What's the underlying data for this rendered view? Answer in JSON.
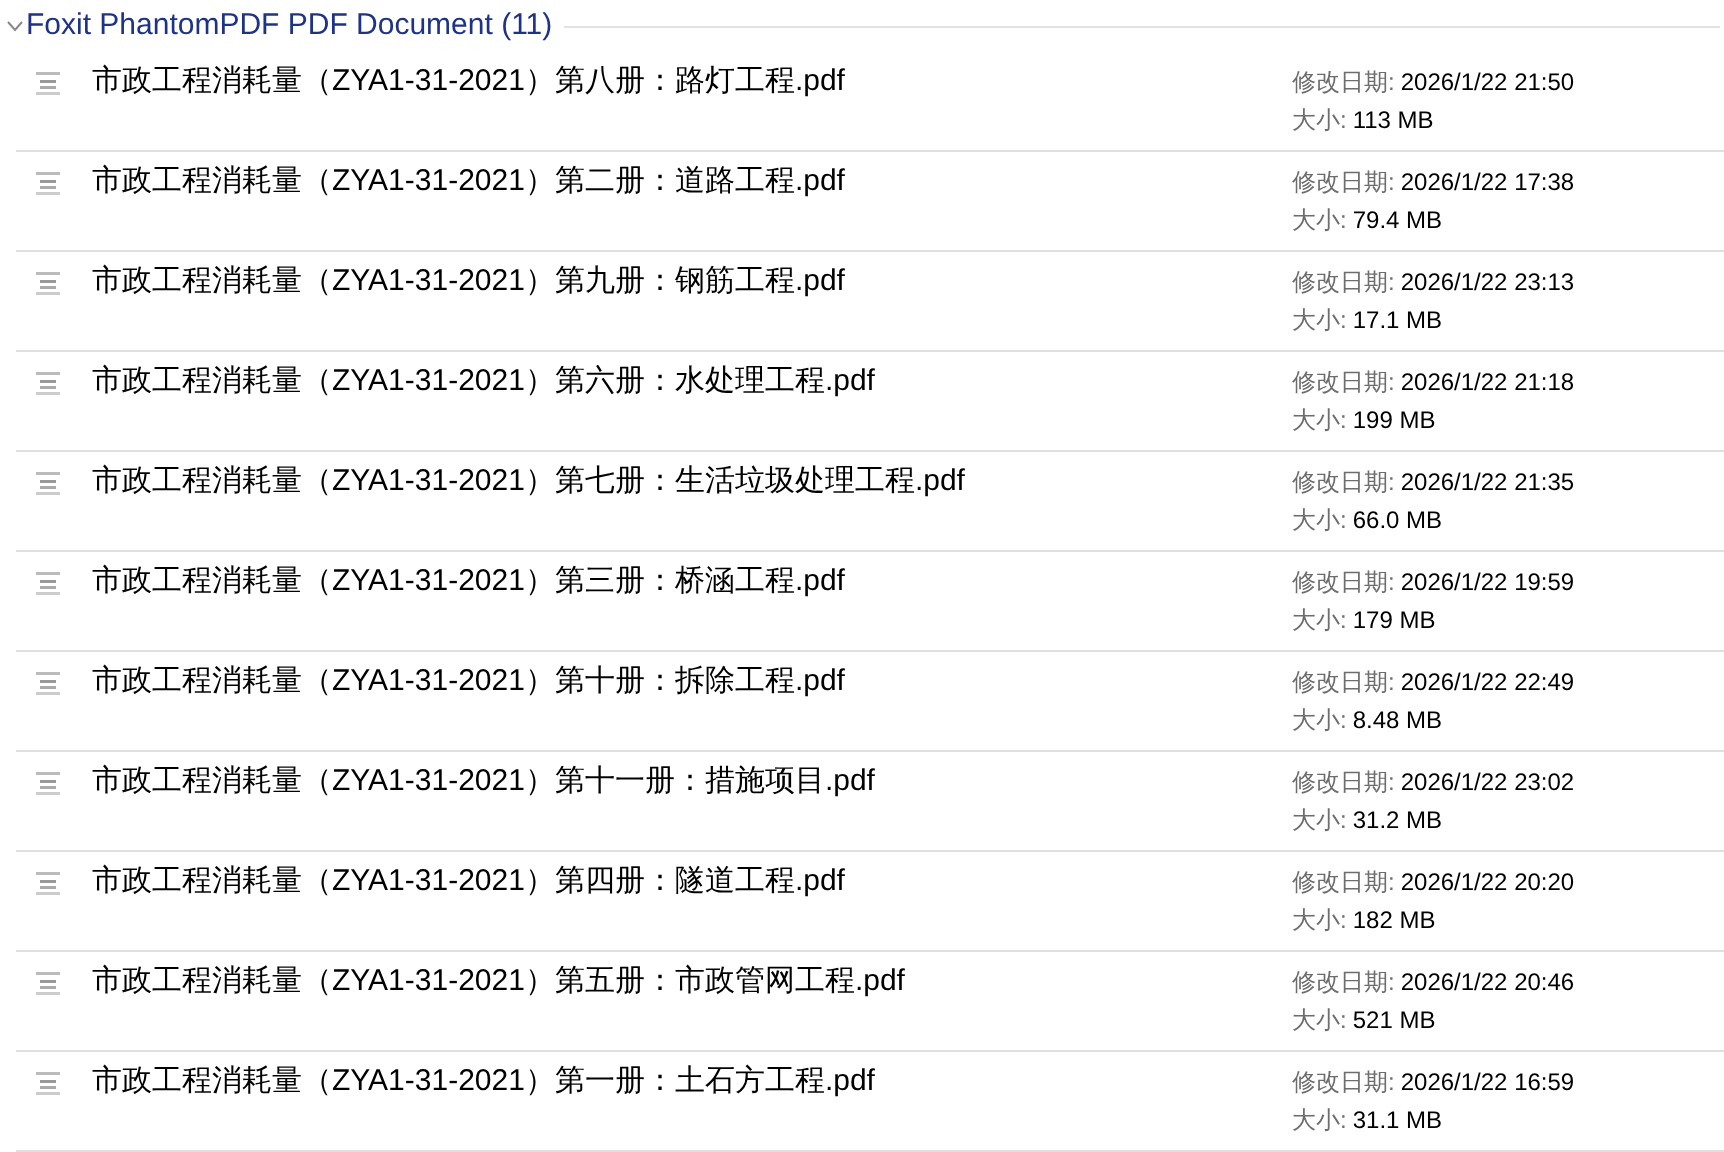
{
  "group": {
    "title": "Foxit PhantomPDF PDF Document (11)",
    "expanded": true
  },
  "files": [
    {
      "name": "市政工程消耗量（ZYA1-31-2021）第八册：路灯工程.pdf",
      "modified_label": "修改日期:",
      "modified": "2026/1/22 21:50",
      "size_label": "大小:",
      "size": "113 MB"
    },
    {
      "name": "市政工程消耗量（ZYA1-31-2021）第二册：道路工程.pdf",
      "modified_label": "修改日期:",
      "modified": "2026/1/22 17:38",
      "size_label": "大小:",
      "size": "79.4 MB"
    },
    {
      "name": "市政工程消耗量（ZYA1-31-2021）第九册：钢筋工程.pdf",
      "modified_label": "修改日期:",
      "modified": "2026/1/22 23:13",
      "size_label": "大小:",
      "size": "17.1 MB"
    },
    {
      "name": "市政工程消耗量（ZYA1-31-2021）第六册：水处理工程.pdf",
      "modified_label": "修改日期:",
      "modified": "2026/1/22 21:18",
      "size_label": "大小:",
      "size": "199 MB"
    },
    {
      "name": "市政工程消耗量（ZYA1-31-2021）第七册：生活垃圾处理工程.pdf",
      "modified_label": "修改日期:",
      "modified": "2026/1/22 21:35",
      "size_label": "大小:",
      "size": "66.0 MB"
    },
    {
      "name": "市政工程消耗量（ZYA1-31-2021）第三册：桥涵工程.pdf",
      "modified_label": "修改日期:",
      "modified": "2026/1/22 19:59",
      "size_label": "大小:",
      "size": "179 MB"
    },
    {
      "name": "市政工程消耗量（ZYA1-31-2021）第十册：拆除工程.pdf",
      "modified_label": "修改日期:",
      "modified": "2026/1/22 22:49",
      "size_label": "大小:",
      "size": "8.48 MB"
    },
    {
      "name": "市政工程消耗量（ZYA1-31-2021）第十一册：措施项目.pdf",
      "modified_label": "修改日期:",
      "modified": "2026/1/22 23:02",
      "size_label": "大小:",
      "size": "31.2 MB"
    },
    {
      "name": "市政工程消耗量（ZYA1-31-2021）第四册：隧道工程.pdf",
      "modified_label": "修改日期:",
      "modified": "2026/1/22 20:20",
      "size_label": "大小:",
      "size": "182 MB"
    },
    {
      "name": "市政工程消耗量（ZYA1-31-2021）第五册：市政管网工程.pdf",
      "modified_label": "修改日期:",
      "modified": "2026/1/22 20:46",
      "size_label": "大小:",
      "size": "521 MB"
    },
    {
      "name": "市政工程消耗量（ZYA1-31-2021）第一册：土石方工程.pdf",
      "modified_label": "修改日期:",
      "modified": "2026/1/22 16:59",
      "size_label": "大小:",
      "size": "31.1 MB"
    }
  ]
}
